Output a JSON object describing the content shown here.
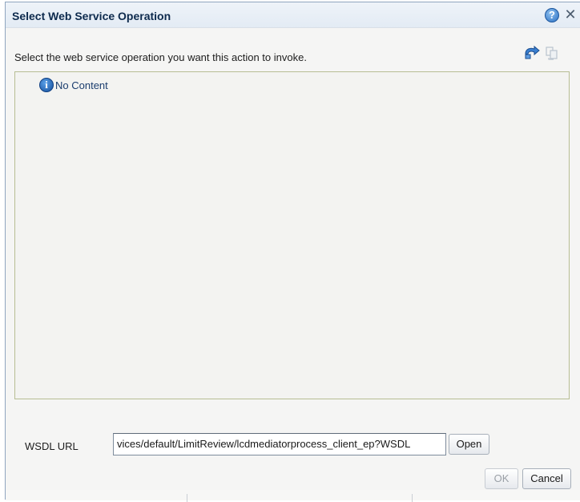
{
  "dialog": {
    "title": "Select Web Service Operation",
    "help_icon": "question-circle-icon",
    "close_icon": "close-icon",
    "instruction": "Select the web service operation you want this action to invoke.",
    "toolbar_icons": [
      "refresh-icon",
      "sync-icon"
    ],
    "content": {
      "info_icon": "info-icon",
      "empty_message": "No Content"
    },
    "wsdl": {
      "label": "WSDL URL",
      "value": "vices/default/LimitReview/lcdmediatorprocess_client_ep?WSDL",
      "open_label": "Open"
    },
    "buttons": {
      "ok_label": "OK",
      "cancel_label": "Cancel"
    }
  },
  "colors": {
    "title_text": "#0d2a4d",
    "panel_border": "#b7bd93",
    "info_blue": "#154f9c"
  }
}
